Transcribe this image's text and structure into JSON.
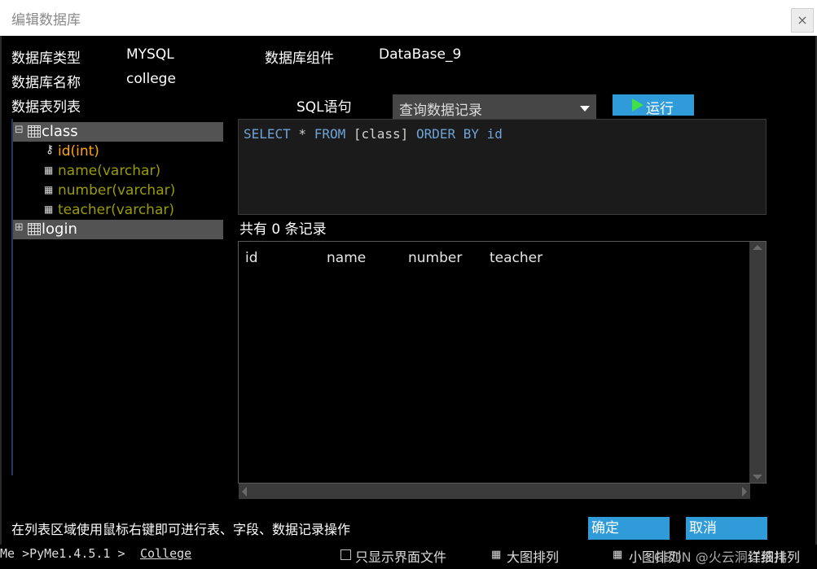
{
  "window": {
    "title": "编辑数据库",
    "close": "×"
  },
  "info": {
    "db_type_label": "数据库类型",
    "db_type_value": "MYSQL",
    "db_component_label": "数据库组件",
    "db_component_value": "DataBase_9",
    "db_name_label": "数据库名称",
    "db_name_value": "college",
    "table_list_label": "数据表列表",
    "sql_label": "SQL语句"
  },
  "tree": {
    "tables": [
      {
        "name": "class",
        "expander": "⊟",
        "fields": [
          {
            "name": "id(int)",
            "kind": "key"
          },
          {
            "name": "name(varchar)",
            "kind": "field"
          },
          {
            "name": "number(varchar)",
            "kind": "field"
          },
          {
            "name": "teacher(varchar)",
            "kind": "field"
          }
        ]
      },
      {
        "name": "login",
        "expander": "⊞"
      }
    ]
  },
  "sql": {
    "selected_option": "查询数据记录",
    "run_label": "运行",
    "query": {
      "select": "SELECT",
      "star": " * ",
      "from": "FROM",
      "table": " [class] ",
      "order": "ORDER BY",
      "col": " id"
    }
  },
  "results": {
    "count_label": "共有 0 条记录",
    "columns": [
      "id",
      "name",
      "number",
      "teacher"
    ]
  },
  "footer": {
    "hint": "在列表区域使用鼠标右键即可进行表、字段、数据记录操作",
    "ok_label": "确定",
    "cancel_label": "取消"
  },
  "bottombar": {
    "path": "Me >PyMe1.4.5.1 >",
    "path_link": "College",
    "show_ui_files": "只显示界面文件",
    "large_icons": "大图排列",
    "small_icons": "小图排列",
    "details": "详细排列",
    "watermark": "CSDN @火云洞红孩儿"
  },
  "colors": {
    "accent": "#2f9bd9",
    "run_icon": "#41e047",
    "key_field": "#ffa500",
    "field": "#9b9b00",
    "keyword": "#6fa3d8"
  }
}
